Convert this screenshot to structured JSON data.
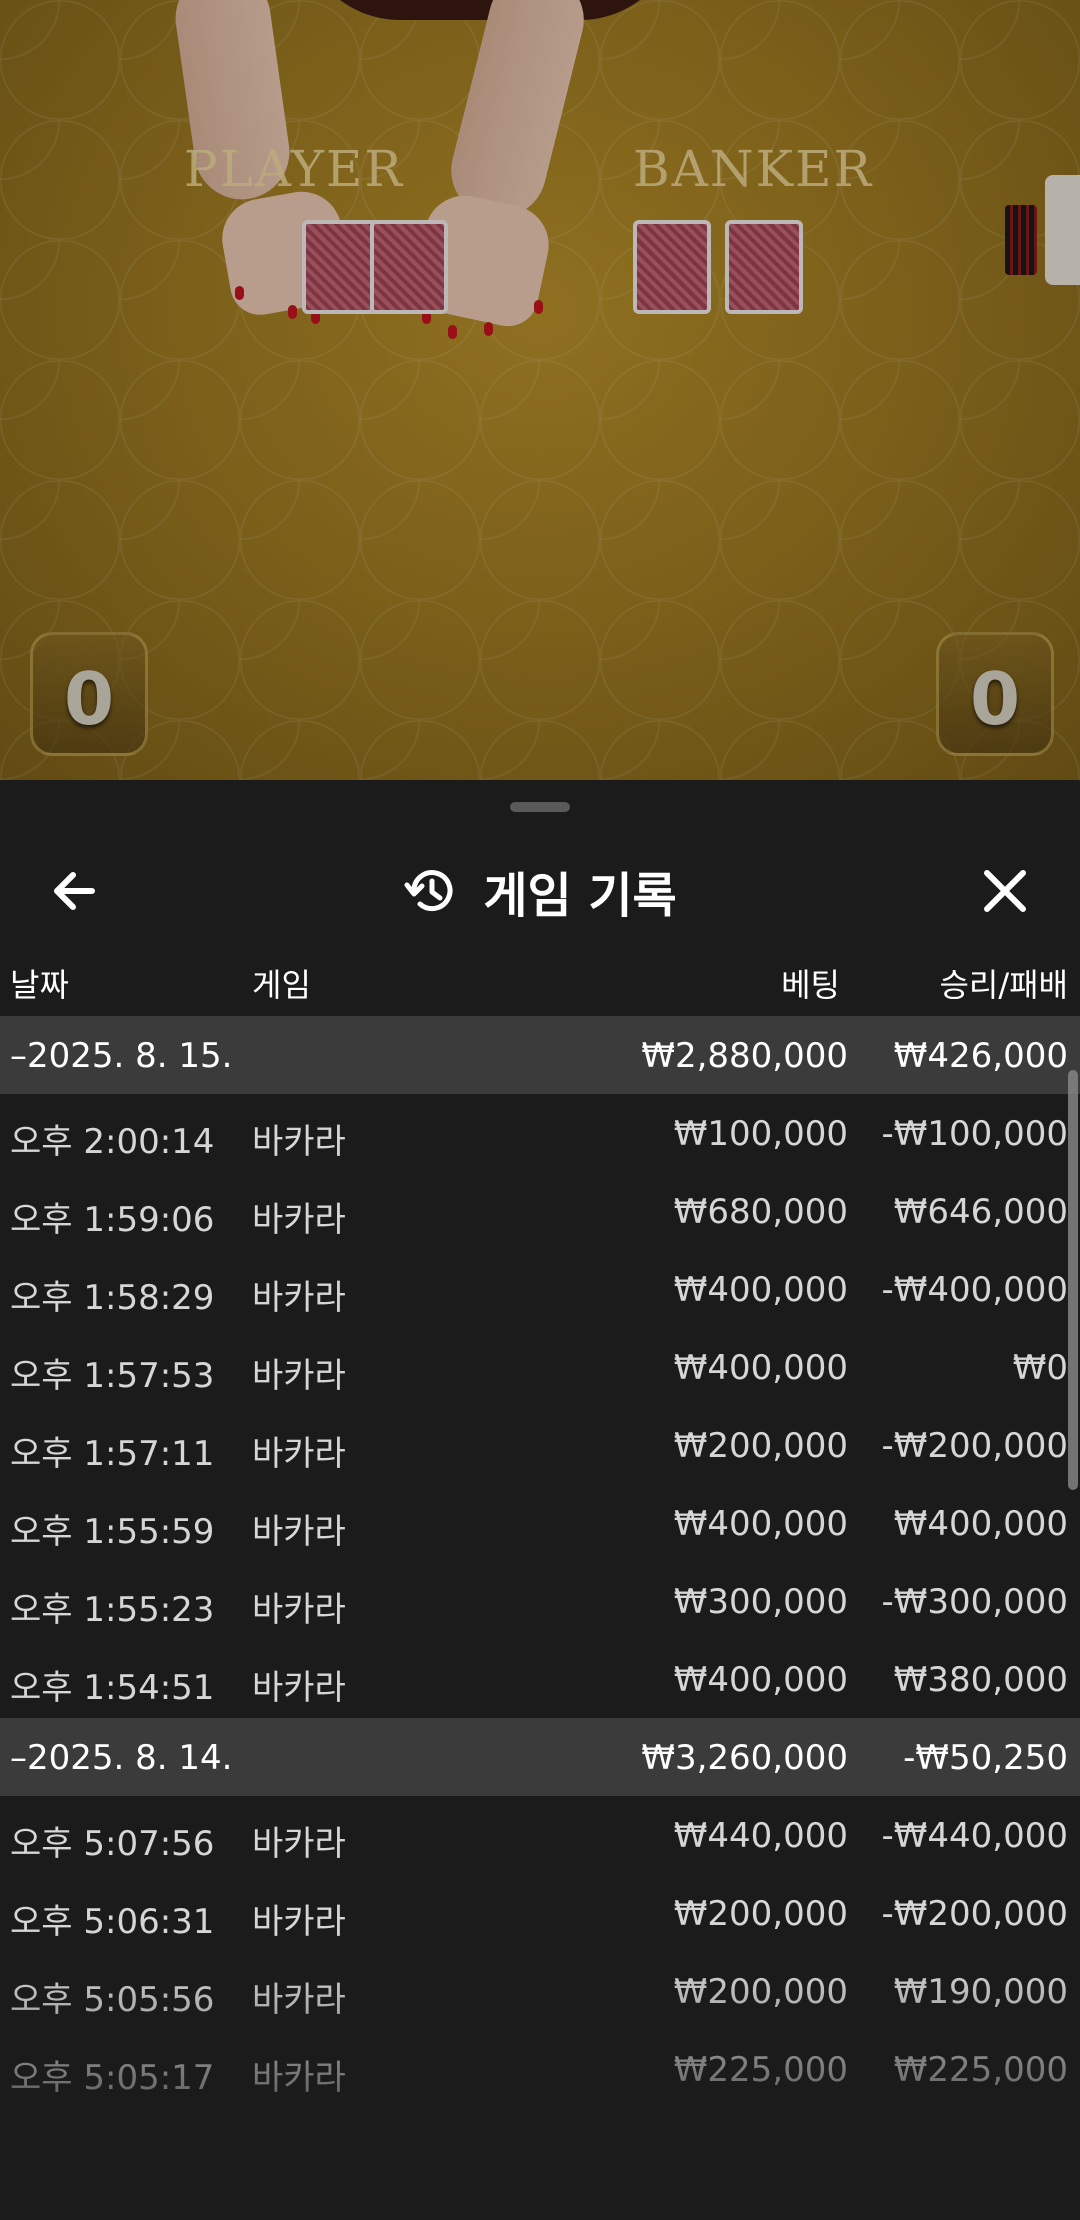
{
  "video": {
    "player_label": "PLAYER",
    "banker_label": "BANKER",
    "player_score": "0",
    "banker_score": "0"
  },
  "sheet": {
    "title": "게임 기록",
    "columns": {
      "date": "날짜",
      "game": "게임",
      "bet": "베팅",
      "result": "승리/패배"
    },
    "groups": [
      {
        "date": "–2025. 8. 15.",
        "bet_total": "₩2,880,000",
        "result_total": "₩426,000",
        "rows": [
          {
            "time": "오후 2:00:14",
            "game": "바카라",
            "bet": "₩100,000",
            "result": "-₩100,000"
          },
          {
            "time": "오후 1:59:06",
            "game": "바카라",
            "bet": "₩680,000",
            "result": "₩646,000"
          },
          {
            "time": "오후 1:58:29",
            "game": "바카라",
            "bet": "₩400,000",
            "result": "-₩400,000"
          },
          {
            "time": "오후 1:57:53",
            "game": "바카라",
            "bet": "₩400,000",
            "result": "₩0"
          },
          {
            "time": "오후 1:57:11",
            "game": "바카라",
            "bet": "₩200,000",
            "result": "-₩200,000"
          },
          {
            "time": "오후 1:55:59",
            "game": "바카라",
            "bet": "₩400,000",
            "result": "₩400,000"
          },
          {
            "time": "오후 1:55:23",
            "game": "바카라",
            "bet": "₩300,000",
            "result": "-₩300,000"
          },
          {
            "time": "오후 1:54:51",
            "game": "바카라",
            "bet": "₩400,000",
            "result": "₩380,000"
          }
        ]
      },
      {
        "date": "–2025. 8. 14.",
        "bet_total": "₩3,260,000",
        "result_total": "-₩50,250",
        "rows": [
          {
            "time": "오후 5:07:56",
            "game": "바카라",
            "bet": "₩440,000",
            "result": "-₩440,000"
          },
          {
            "time": "오후 5:06:31",
            "game": "바카라",
            "bet": "₩200,000",
            "result": "-₩200,000"
          },
          {
            "time": "오후 5:05:56",
            "game": "바카라",
            "bet": "₩200,000",
            "result": "₩190,000"
          },
          {
            "time": "오후 5:05:17",
            "game": "바카라",
            "bet": "₩225,000",
            "result": "₩225,000"
          }
        ]
      }
    ]
  },
  "icons": {
    "back": "arrow-left-icon",
    "history": "history-icon",
    "close": "close-icon"
  }
}
